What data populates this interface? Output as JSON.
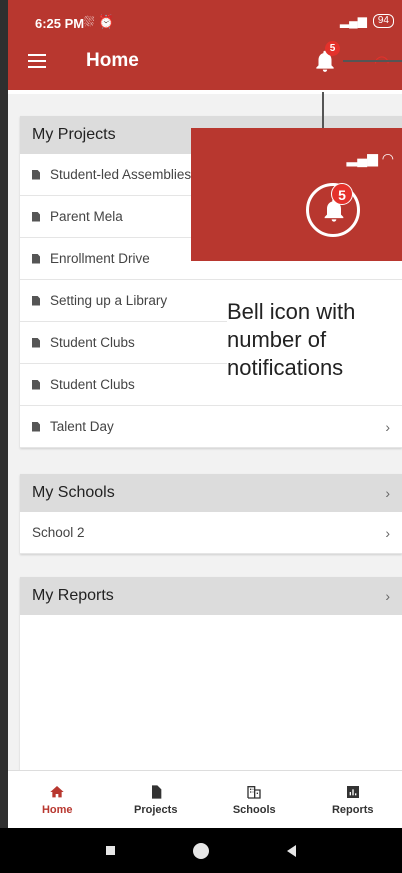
{
  "status_bar": {
    "time": "6:25 PM",
    "icons": "⛆ ⏰",
    "signal": "▂▄▆",
    "battery": "94"
  },
  "app_bar": {
    "title": "Home",
    "notification_count": "5"
  },
  "projects": {
    "header": "My Projects",
    "items": [
      "Student-led Assemblies",
      "Parent Mela",
      "Enrollment Drive",
      "Setting up a Library",
      "Student Clubs",
      "Student Clubs",
      "Talent Day"
    ]
  },
  "schools": {
    "header": "My Schools",
    "items": [
      "School 2"
    ]
  },
  "reports": {
    "header": "My Reports"
  },
  "overlay": {
    "badge": "5",
    "caption": "Bell icon with number of notifications"
  },
  "bottom_nav": [
    {
      "label": "Home",
      "icon": "home-icon"
    },
    {
      "label": "Projects",
      "icon": "document-icon"
    },
    {
      "label": "Schools",
      "icon": "building-icon"
    },
    {
      "label": "Reports",
      "icon": "bar-chart-icon"
    }
  ],
  "colors": {
    "primary": "#b8372f",
    "badge": "#e4312b"
  }
}
